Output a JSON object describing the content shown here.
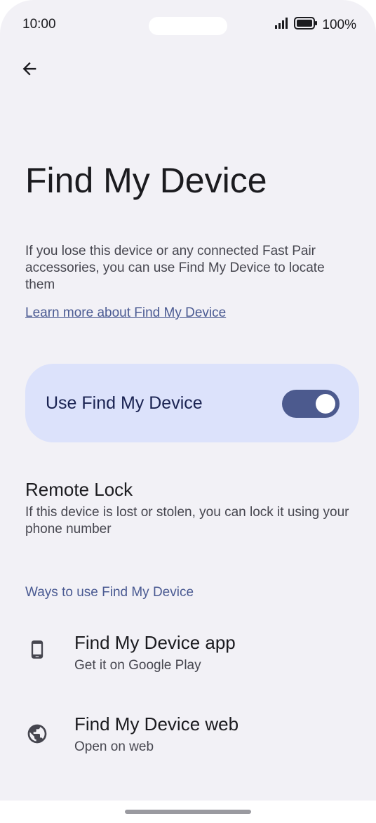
{
  "status_bar": {
    "time": "10:00",
    "battery": "100%",
    "icons": [
      "signal-icon",
      "battery-icon"
    ]
  },
  "header": {
    "back_icon": "arrow-left-icon",
    "title": "Find My Device"
  },
  "intro": {
    "description": "If you lose this device or any connected Fast Pair accessories, you can use Find My Device to locate them",
    "learn_more": "Learn more about Find My Device"
  },
  "toggle": {
    "label": "Use Find My Device",
    "enabled": true
  },
  "remote_lock": {
    "title": "Remote Lock",
    "description": "If this device is lost or stolen, you can lock it using your phone number"
  },
  "ways": {
    "header": "Ways to use Find My Device",
    "items": [
      {
        "title": "Find My Device app",
        "subtitle": "Get it on Google Play",
        "icon": "phone-icon"
      },
      {
        "title": "Find My Device web",
        "subtitle": "Open on web",
        "icon": "globe-icon"
      }
    ]
  },
  "colors": {
    "background": "#f2f1f6",
    "accent": "#4c5a8e",
    "card": "#dce2fb",
    "link": "#4a5a92"
  }
}
